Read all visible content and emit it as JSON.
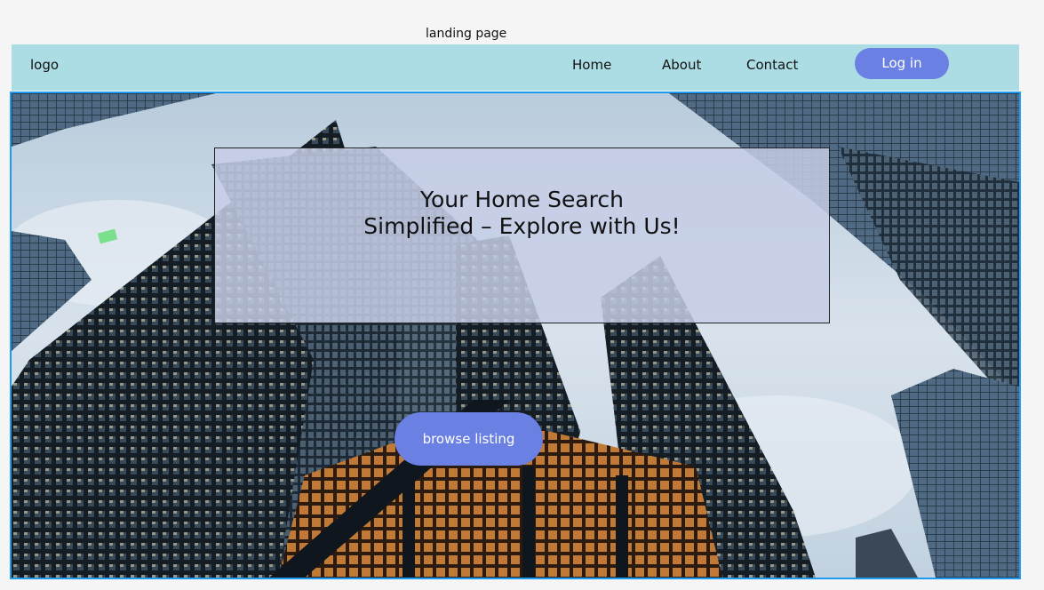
{
  "page": {
    "frame_title": "landing page"
  },
  "navbar": {
    "logo": "logo",
    "links": [
      "Home",
      "About",
      "Contact"
    ],
    "login_label": "Log in"
  },
  "hero": {
    "headline_line1": "Your Home Search",
    "headline_line2": "Simplified – Explore with Us!",
    "cta_label": "browse listing"
  },
  "colors": {
    "navbar_bg": "#acdde4",
    "button": "#6b80e3",
    "hero_border": "#1e9bf0"
  }
}
